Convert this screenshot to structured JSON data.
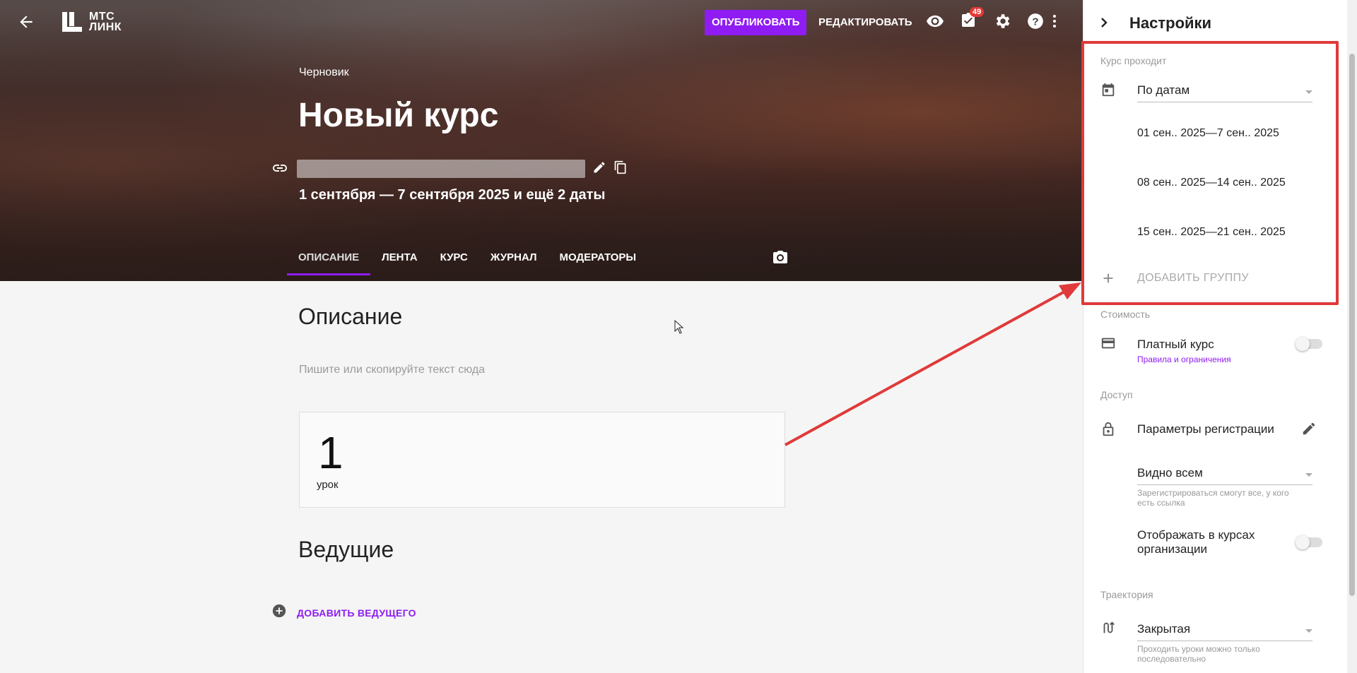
{
  "header": {
    "logo_line1": "МТС",
    "logo_line2": "ЛИНК",
    "publish_label": "ОПУБЛИКОВАТЬ",
    "edit_label": "РЕДАКТИРОВАТЬ",
    "notifications_count": "49"
  },
  "course": {
    "status": "Черновик",
    "title": "Новый курс",
    "dates": "1 сентября — 7 сентября 2025 и ещё 2 даты"
  },
  "tabs": [
    {
      "label": "ОПИСАНИЕ",
      "active": true
    },
    {
      "label": "ЛЕНТА",
      "active": false
    },
    {
      "label": "КУРС",
      "active": false
    },
    {
      "label": "ЖУРНАЛ",
      "active": false
    },
    {
      "label": "МОДЕРАТОРЫ",
      "active": false
    }
  ],
  "description": {
    "heading": "Описание",
    "placeholder": "Пишите или скопируйте текст сюда"
  },
  "lessons": {
    "count": "1",
    "label": "урок"
  },
  "hosts": {
    "heading": "Ведущие",
    "add_label": "ДОБАВИТЬ ВЕДУЩЕГО"
  },
  "settings": {
    "title": "Настройки",
    "schedule": {
      "group_label": "Курс проходит",
      "mode": "По датам",
      "groups": [
        "01 сен.. 2025—7 сен.. 2025",
        "08 сен.. 2025—14 сен.. 2025",
        "15 сен.. 2025—21 сен.. 2025"
      ],
      "add_group_label": "ДОБАВИТЬ ГРУППУ"
    },
    "cost": {
      "group_label": "Стоимость",
      "paid_label": "Платный курс",
      "paid_enabled": false,
      "rules_link": "Правила и ограничения"
    },
    "access": {
      "group_label": "Доступ",
      "registration_label": "Параметры регистрации",
      "visibility": "Видно всем",
      "visibility_hint": "Зарегистрироваться смогут все, у кого есть ссылка",
      "show_in_org_label": "Отображать в курсах организации",
      "show_in_org_enabled": false
    },
    "trajectory": {
      "group_label": "Траектория",
      "mode": "Закрытая",
      "hint": "Проходить уроки можно только последовательно"
    }
  },
  "colors": {
    "accent": "#8f1cf2",
    "annotation": "#e03a3a"
  }
}
